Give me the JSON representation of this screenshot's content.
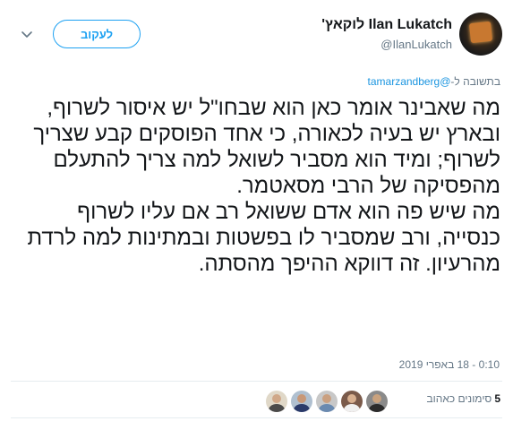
{
  "user": {
    "display_name": "Ilan Lukatch לוקאץ'",
    "handle": "@IlanLukatch"
  },
  "follow_label": "לעקוב",
  "reply_to": {
    "prefix": "בתשובה ל-",
    "mention": "@tamarzandberg"
  },
  "tweet": {
    "paragraph_1": "מה שאבינר אומר כאן הוא שבחו\"ל יש איסור לשרוף, ובארץ יש בעיה לכאורה, כי אחד הפוסקים קבע שצריך לשרוף; ומיד הוא מסביר לשואל למה צריך להתעלם מהפסיקה של הרבי מסאטמר.",
    "paragraph_2": "מה שיש פה הוא אדם ששואל רב אם עליו לשרוף כנסייה, ורב שמסביר לו בפשטות ובמתינות למה לרדת מהרעיון. זה דווקא ההיפך מהסתה."
  },
  "timestamp": "0:10 - 18 באפרי 2019",
  "likes": {
    "count": "5",
    "label": "סימונים כאהוב"
  },
  "colors": {
    "accent": "#1da1f2",
    "muted": "#657786",
    "text": "#14171a"
  },
  "icons": {
    "caret": "chevron-down-icon"
  }
}
